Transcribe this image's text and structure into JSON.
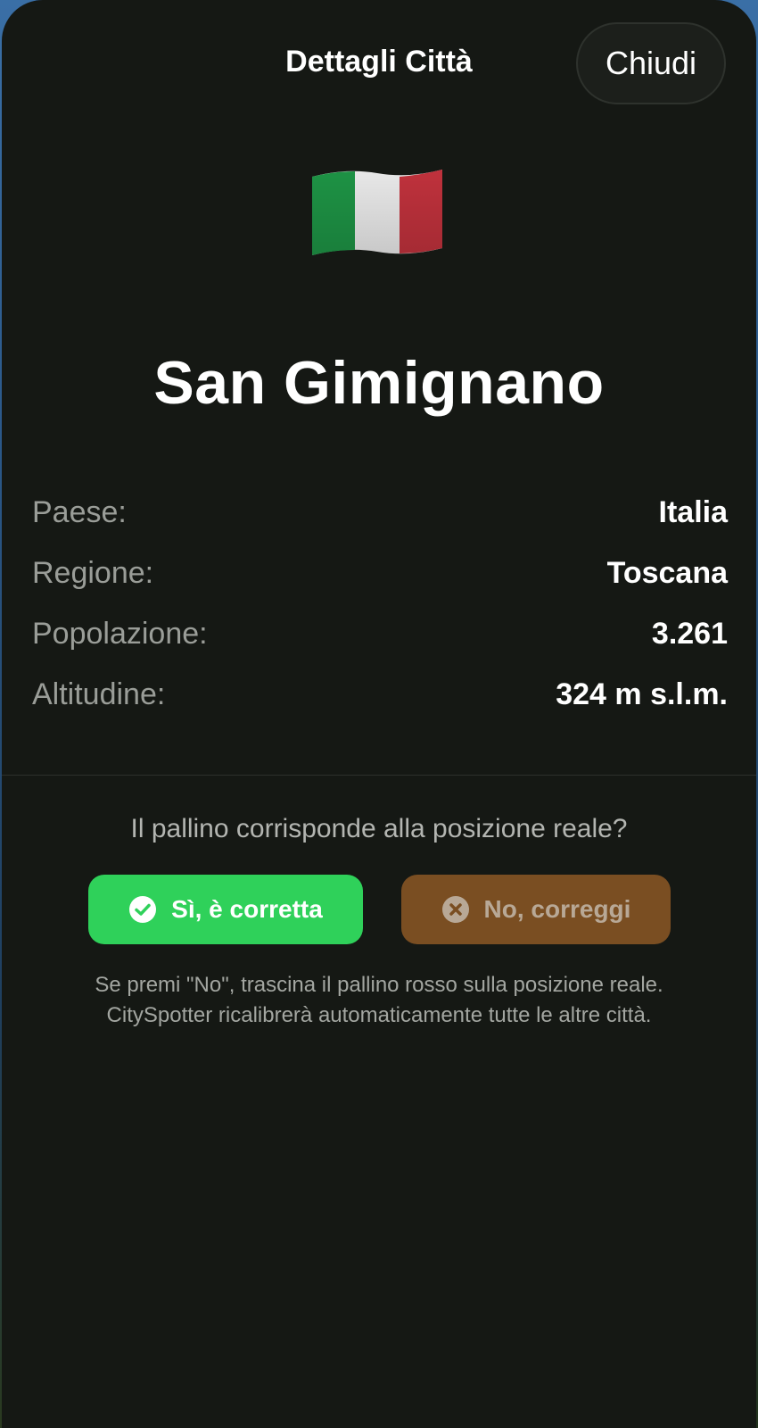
{
  "header": {
    "title": "Dettagli Città",
    "close_label": "Chiudi"
  },
  "city": {
    "flag_icon": "italy-flag-icon",
    "name": "San Gimignano"
  },
  "details": [
    {
      "label": "Paese:",
      "value": "Italia"
    },
    {
      "label": "Regione:",
      "value": "Toscana"
    },
    {
      "label": "Popolazione:",
      "value": "3.261"
    },
    {
      "label": "Altitudine:",
      "value": "324 m s.l.m."
    }
  ],
  "confirmation": {
    "question": "Il pallino corrisponde alla posizione reale?",
    "yes_label": "Sì, è corretta",
    "yes_icon": "check-circle-icon",
    "no_label": "No, correggi",
    "no_icon": "x-circle-icon",
    "hint_line1": "Se premi \"No\", trascina il pallino rosso sulla posizione reale.",
    "hint_line2": "CitySpotter ricalibrerà automaticamente tutte le altre città."
  },
  "colors": {
    "sheet_bg": "#151814",
    "yes_button": "#2fd15a",
    "no_button": "#7a4e22",
    "flag_green": "#1f9a48",
    "flag_white": "#f4f4f4",
    "flag_red": "#c9343f"
  }
}
